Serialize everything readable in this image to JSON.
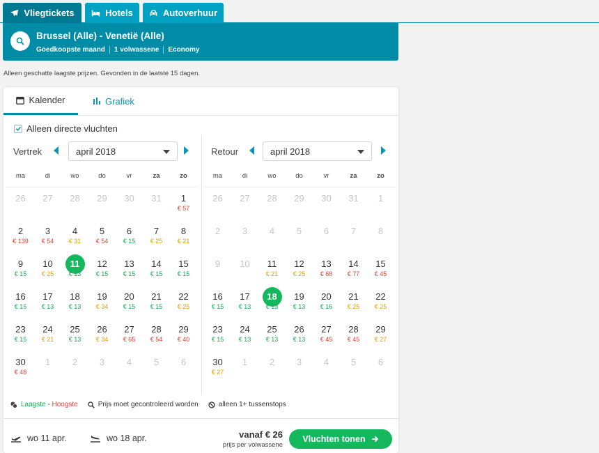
{
  "tabs": [
    {
      "label": "Vliegtickets",
      "icon": "plane-icon",
      "active": true
    },
    {
      "label": "Hotels",
      "icon": "bed-icon",
      "active": false
    },
    {
      "label": "Autoverhuur",
      "icon": "car-icon",
      "active": false
    }
  ],
  "search": {
    "route": "Brussel (Alle) - Venetië (Alle)",
    "meta": [
      "Goedkoopste maand",
      "1 volwassene",
      "Economy"
    ]
  },
  "notice": "Alleen geschatte laagste prijzen. Gevonden in de laatste 15 dagen.",
  "view_tabs": {
    "calendar": "Kalender",
    "chart": "Grafiek"
  },
  "direct_only": {
    "label": "Alleen directe vluchten",
    "checked": true
  },
  "weekdays": [
    "ma",
    "di",
    "wo",
    "do",
    "vr",
    "za",
    "zo"
  ],
  "departure": {
    "label": "Vertrek",
    "month": "april 2018",
    "selected": "11",
    "weeks": [
      [
        {
          "d": "26",
          "m": true
        },
        {
          "d": "27",
          "m": true
        },
        {
          "d": "28",
          "m": true
        },
        {
          "d": "29",
          "m": true
        },
        {
          "d": "30",
          "m": true
        },
        {
          "d": "31",
          "m": true
        },
        {
          "d": "1",
          "p": "€ 57",
          "c": "red"
        }
      ],
      [
        {
          "d": "2",
          "p": "€ 139",
          "c": "red"
        },
        {
          "d": "3",
          "p": "€ 54",
          "c": "red"
        },
        {
          "d": "4",
          "p": "€ 31",
          "c": "orange"
        },
        {
          "d": "5",
          "p": "€ 54",
          "c": "red"
        },
        {
          "d": "6",
          "p": "€ 15",
          "c": "green"
        },
        {
          "d": "7",
          "p": "€ 25",
          "c": "orange"
        },
        {
          "d": "8",
          "p": "€ 21",
          "c": "orange"
        }
      ],
      [
        {
          "d": "9",
          "p": "€ 15",
          "c": "green"
        },
        {
          "d": "10",
          "p": "€ 25",
          "c": "orange"
        },
        {
          "d": "11",
          "p": "€ 13",
          "c": "green",
          "s": true
        },
        {
          "d": "12",
          "p": "€ 15",
          "c": "green"
        },
        {
          "d": "13",
          "p": "€ 15",
          "c": "green"
        },
        {
          "d": "14",
          "p": "€ 15",
          "c": "green"
        },
        {
          "d": "15",
          "p": "€ 15",
          "c": "green"
        }
      ],
      [
        {
          "d": "16",
          "p": "€ 15",
          "c": "green"
        },
        {
          "d": "17",
          "p": "€ 13",
          "c": "green"
        },
        {
          "d": "18",
          "p": "€ 13",
          "c": "green"
        },
        {
          "d": "19",
          "p": "€ 34",
          "c": "orange"
        },
        {
          "d": "20",
          "p": "€ 15",
          "c": "green"
        },
        {
          "d": "21",
          "p": "€ 15",
          "c": "green"
        },
        {
          "d": "22",
          "p": "€ 25",
          "c": "orange"
        }
      ],
      [
        {
          "d": "23",
          "p": "€ 15",
          "c": "green"
        },
        {
          "d": "24",
          "p": "€ 21",
          "c": "orange"
        },
        {
          "d": "25",
          "p": "€ 13",
          "c": "green"
        },
        {
          "d": "26",
          "p": "€ 34",
          "c": "orange"
        },
        {
          "d": "27",
          "p": "€ 65",
          "c": "red"
        },
        {
          "d": "28",
          "p": "€ 54",
          "c": "red"
        },
        {
          "d": "29",
          "p": "€ 40",
          "c": "red"
        }
      ],
      [
        {
          "d": "30",
          "p": "€ 48",
          "c": "red"
        },
        {
          "d": "1",
          "m": true
        },
        {
          "d": "2",
          "m": true
        },
        {
          "d": "3",
          "m": true
        },
        {
          "d": "4",
          "m": true
        },
        {
          "d": "5",
          "m": true
        },
        {
          "d": "6",
          "m": true
        }
      ]
    ]
  },
  "return": {
    "label": "Retour",
    "month": "april 2018",
    "selected": "18",
    "weeks": [
      [
        {
          "d": "26",
          "m": true
        },
        {
          "d": "27",
          "m": true
        },
        {
          "d": "28",
          "m": true
        },
        {
          "d": "29",
          "m": true
        },
        {
          "d": "30",
          "m": true
        },
        {
          "d": "31",
          "m": true
        },
        {
          "d": "1",
          "m": true
        }
      ],
      [
        {
          "d": "2",
          "m": true
        },
        {
          "d": "3",
          "m": true
        },
        {
          "d": "4",
          "m": true
        },
        {
          "d": "5",
          "m": true
        },
        {
          "d": "6",
          "m": true
        },
        {
          "d": "7",
          "m": true
        },
        {
          "d": "8",
          "m": true
        }
      ],
      [
        {
          "d": "9",
          "m": true
        },
        {
          "d": "10",
          "m": true
        },
        {
          "d": "11",
          "p": "€ 21",
          "c": "orange"
        },
        {
          "d": "12",
          "p": "€ 25",
          "c": "orange"
        },
        {
          "d": "13",
          "p": "€ 68",
          "c": "red"
        },
        {
          "d": "14",
          "p": "€ 77",
          "c": "red"
        },
        {
          "d": "15",
          "p": "€ 45",
          "c": "red"
        }
      ],
      [
        {
          "d": "16",
          "p": "€ 15",
          "c": "green"
        },
        {
          "d": "17",
          "p": "€ 13",
          "c": "green"
        },
        {
          "d": "18",
          "p": "€ 13",
          "c": "green",
          "s": true
        },
        {
          "d": "19",
          "p": "€ 13",
          "c": "green"
        },
        {
          "d": "20",
          "p": "€ 16",
          "c": "green"
        },
        {
          "d": "21",
          "p": "€ 25",
          "c": "orange"
        },
        {
          "d": "22",
          "p": "€ 25",
          "c": "orange"
        }
      ],
      [
        {
          "d": "23",
          "p": "€ 15",
          "c": "green"
        },
        {
          "d": "24",
          "p": "€ 13",
          "c": "green"
        },
        {
          "d": "25",
          "p": "€ 13",
          "c": "green"
        },
        {
          "d": "26",
          "p": "€ 13",
          "c": "green"
        },
        {
          "d": "27",
          "p": "€ 45",
          "c": "red"
        },
        {
          "d": "28",
          "p": "€ 45",
          "c": "red"
        },
        {
          "d": "29",
          "p": "€ 27",
          "c": "orange"
        }
      ],
      [
        {
          "d": "30",
          "p": "€ 27",
          "c": "orange"
        },
        {
          "d": "1",
          "m": true
        },
        {
          "d": "2",
          "m": true
        },
        {
          "d": "3",
          "m": true
        },
        {
          "d": "4",
          "m": true
        },
        {
          "d": "5",
          "m": true
        },
        {
          "d": "6",
          "m": true
        }
      ]
    ]
  },
  "legend": {
    "low": "Laagste",
    "sep": " - ",
    "high": "Hoogste",
    "check": "Prijs moet gecontroleerd worden",
    "stops": "alleen 1+ tussenstops"
  },
  "footer": {
    "depart_date": "wo 11 apr.",
    "return_date": "wo 18 apr.",
    "price": "vanaf € 26",
    "price_sub": "prijs per volwassene",
    "cta": "Vluchten tonen"
  },
  "colors": {
    "accent": "#008ba6",
    "green": "#15a84f",
    "orange": "#e2a100",
    "red": "#e2402f"
  }
}
